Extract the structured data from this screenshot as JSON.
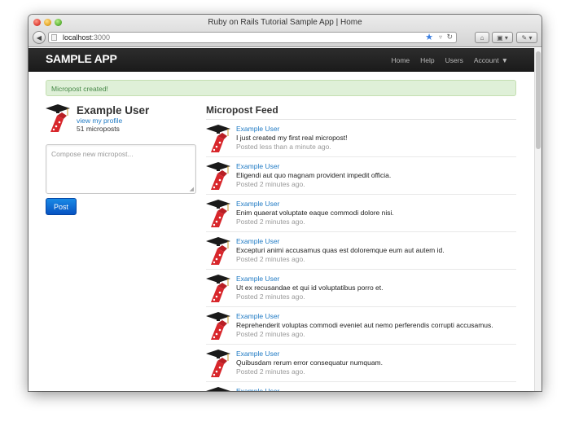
{
  "window": {
    "title": "Ruby on Rails Tutorial Sample App | Home"
  },
  "browser": {
    "url_host": "localhost",
    "url_port": ":3000",
    "icons": [
      "back-arrow-icon",
      "page-icon",
      "bookmark-star-icon",
      "dropdown-icon",
      "reload-icon",
      "home-icon",
      "tabs-icon",
      "extensions-icon"
    ]
  },
  "navbar": {
    "brand": "SAMPLE APP",
    "links": [
      "Home",
      "Help",
      "Users",
      "Account"
    ]
  },
  "flash": "Micropost created!",
  "profile": {
    "name": "Example User",
    "link": "view my profile",
    "count": "51 microposts"
  },
  "compose": {
    "placeholder": "Compose new micropost...",
    "button": "Post"
  },
  "feed": {
    "title": "Micropost Feed",
    "items": [
      {
        "user": "Example User",
        "content": "I just created my first real micropost!",
        "time": "Posted less than a minute ago."
      },
      {
        "user": "Example User",
        "content": "Eligendi aut quo magnam provident impedit officia.",
        "time": "Posted 2 minutes ago."
      },
      {
        "user": "Example User",
        "content": "Enim quaerat voluptate eaque commodi dolore nisi.",
        "time": "Posted 2 minutes ago."
      },
      {
        "user": "Example User",
        "content": "Excepturi animi accusamus quas est doloremque eum aut autem id.",
        "time": "Posted 2 minutes ago."
      },
      {
        "user": "Example User",
        "content": "Ut ex recusandae et qui id voluptatibus porro et.",
        "time": "Posted 2 minutes ago."
      },
      {
        "user": "Example User",
        "content": "Reprehenderit voluptas commodi eveniet aut nemo perferendis corrupti accusamus.",
        "time": "Posted 2 minutes ago."
      },
      {
        "user": "Example User",
        "content": "Quibusdam rerum error consequatur numquam.",
        "time": "Posted 2 minutes ago."
      },
      {
        "user": "Example User",
        "content": "",
        "time": ""
      }
    ]
  },
  "colors": {
    "link": "#1f7ac4",
    "navbar": "#222222",
    "alert_bg": "#dff0d8",
    "alert_text": "#468847",
    "button": "#0b5ec9"
  }
}
